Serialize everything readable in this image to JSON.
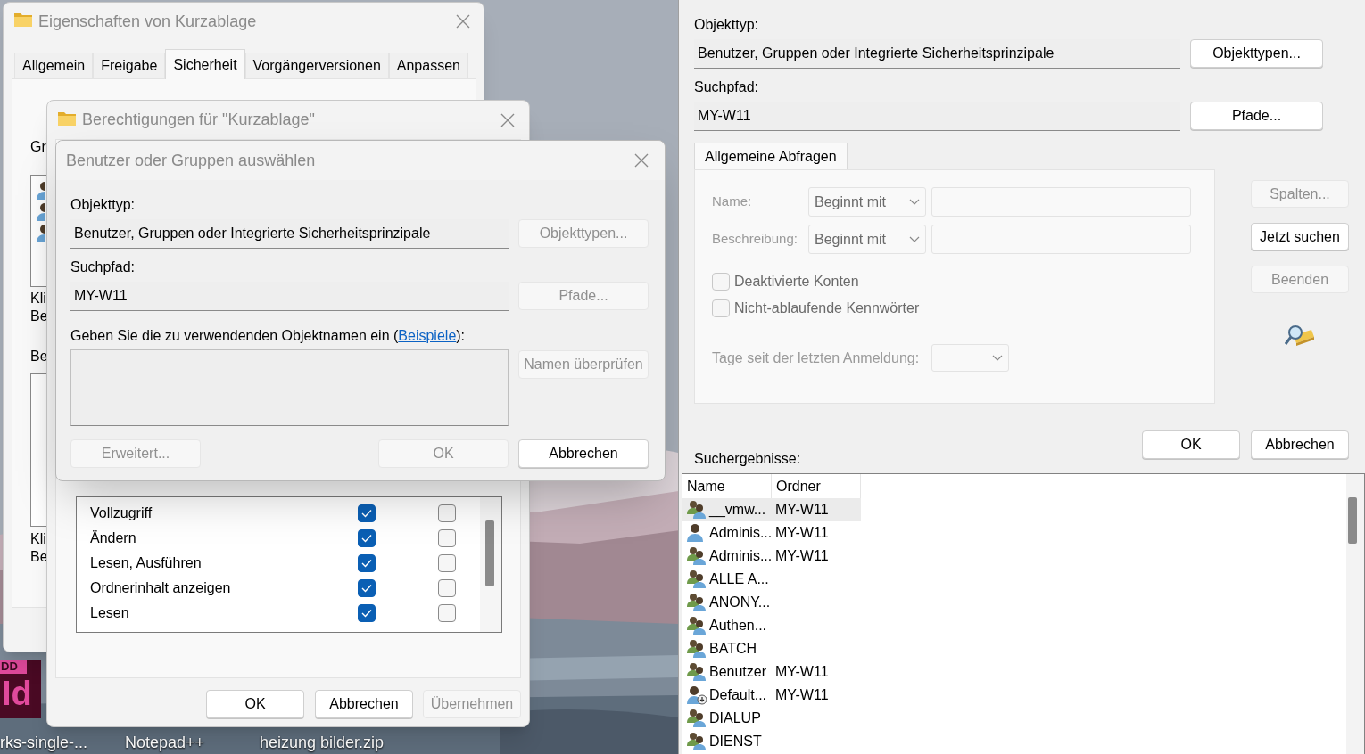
{
  "desktop": {
    "icons": [
      {
        "badge": "DD",
        "glyph": "Id",
        "label": "rks-single-..."
      },
      {
        "label": "Notepad++"
      },
      {
        "label": "heizung bilder.zip"
      }
    ]
  },
  "properties_window": {
    "title": "Eigenschaften von Kurzablage",
    "tabs": [
      {
        "label": "Allgemein",
        "selected": false
      },
      {
        "label": "Freigabe",
        "selected": false
      },
      {
        "label": "Sicherheit",
        "selected": true
      },
      {
        "label": "Vorgängerversionen",
        "selected": false
      },
      {
        "label": "Anpassen",
        "selected": false
      }
    ],
    "groups_label_fragment": "Gr",
    "hint_fragment_lines": [
      "Kli",
      "Be"
    ],
    "permissions_label_fragment": "Be",
    "advanced_hint_fragment_lines": [
      "Kli",
      "Be"
    ]
  },
  "permissions_window": {
    "title": "Berechtigungen für \"Kurzablage\"",
    "permissions": [
      {
        "name": "Vollzugriff",
        "allow": true,
        "deny": false
      },
      {
        "name": "Ändern",
        "allow": true,
        "deny": false
      },
      {
        "name": "Lesen, Ausführen",
        "allow": true,
        "deny": false
      },
      {
        "name": "Ordnerinhalt anzeigen",
        "allow": true,
        "deny": false
      },
      {
        "name": "Lesen",
        "allow": true,
        "deny": false
      }
    ],
    "buttons": [
      {
        "label": "OK",
        "disabled": false
      },
      {
        "label": "Abbrechen",
        "disabled": false
      },
      {
        "label": "Übernehmen",
        "disabled": true
      }
    ]
  },
  "select_dialog": {
    "title": "Benutzer oder Gruppen auswählen",
    "object_type_label": "Objekttyp:",
    "object_type": "Benutzer, Gruppen oder Integrierte Sicherheitsprinzipale",
    "object_types_button": {
      "label": "Objekttypen...",
      "disabled": true
    },
    "search_path_label": "Suchpfad:",
    "search_path": "MY-W11",
    "paths_button": {
      "label": "Pfade...",
      "disabled": true
    },
    "names_prompt": {
      "before": "Geben Sie die zu verwendenden Objektnamen ein (",
      "link": "Beispiele",
      "after": "):"
    },
    "check_names_button": {
      "label": "Namen überprüfen",
      "disabled": true
    },
    "buttons": [
      {
        "label": "Erweitert...",
        "disabled": true
      },
      {
        "label": "OK",
        "disabled": true
      },
      {
        "label": "Abbrechen",
        "disabled": false
      }
    ]
  },
  "advanced_dialog": {
    "object_type_label": "Objekttyp:",
    "object_type": "Benutzer, Gruppen oder Integrierte Sicherheitsprinzipale",
    "object_types_button": {
      "label": "Objekttypen...",
      "disabled": false
    },
    "search_path_label": "Suchpfad:",
    "search_path": "MY-W11",
    "paths_button": {
      "label": "Pfade...",
      "disabled": false
    },
    "tabs": [
      {
        "label": "Allgemeine Abfragen",
        "selected": true
      }
    ],
    "query": {
      "name_label": "Name:",
      "name_operator": "Beginnt mit",
      "description_label": "Beschreibung:",
      "description_operator": "Beginnt mit",
      "options": [
        {
          "label": "Deaktivierte Konten",
          "checked": false
        },
        {
          "label": "Nicht-ablaufende Kennwörter",
          "checked": false
        }
      ],
      "days_label": "Tage seit der letzten Anmeldung:"
    },
    "side_buttons": [
      {
        "label": "Spalten...",
        "disabled": true
      },
      {
        "label": "Jetzt suchen",
        "disabled": false
      },
      {
        "label": "Beenden",
        "disabled": true
      }
    ],
    "buttons": [
      {
        "label": "OK",
        "disabled": false
      },
      {
        "label": "Abbrechen",
        "disabled": false
      }
    ],
    "results_label": "Suchergebnisse:",
    "results": {
      "columns": [
        "Name",
        "Ordner"
      ],
      "rows": [
        {
          "kind": "group",
          "name": "__vmw...",
          "folder": "MY-W11",
          "selected": true
        },
        {
          "kind": "user",
          "name": "Adminis...",
          "folder": "MY-W11",
          "selected": false
        },
        {
          "kind": "group",
          "name": "Adminis...",
          "folder": "MY-W11",
          "selected": false
        },
        {
          "kind": "group",
          "name": "ALLE A...",
          "selected": false
        },
        {
          "kind": "group",
          "name": "ANONY...",
          "selected": false
        },
        {
          "kind": "group",
          "name": "Authen...",
          "selected": false
        },
        {
          "kind": "group",
          "name": "BATCH",
          "selected": false
        },
        {
          "kind": "group",
          "name": "Benutzer",
          "folder": "MY-W11",
          "selected": false
        },
        {
          "kind": "managed-user",
          "name": "Default...",
          "folder": "MY-W11",
          "selected": false
        },
        {
          "kind": "group",
          "name": "DIALUP",
          "selected": false
        },
        {
          "kind": "group",
          "name": "DIENST",
          "selected": false
        }
      ]
    }
  }
}
